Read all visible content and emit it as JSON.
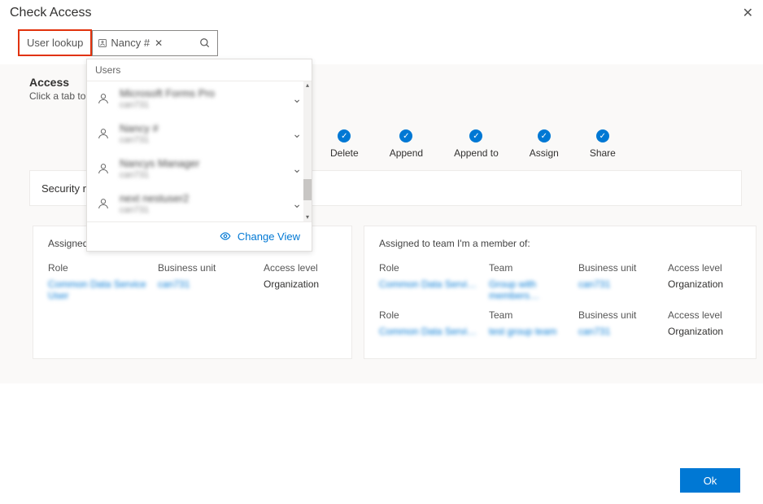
{
  "dialog": {
    "title": "Check Access",
    "close_aria": "Close"
  },
  "lookup": {
    "label": "User lookup",
    "chip_text": "Nancy #",
    "dropdown_header": "Users",
    "change_view": "Change View",
    "results": [
      {
        "primary": "Microsoft Forms Pro",
        "secondary": "can731"
      },
      {
        "primary": "Nancy #",
        "secondary": "can731"
      },
      {
        "primary": "Nancys Manager",
        "secondary": "can731"
      },
      {
        "primary": "next nestuser2",
        "secondary": "can731"
      }
    ]
  },
  "access": {
    "heading": "Access",
    "subtitle": "Click a tab to",
    "permissions": [
      {
        "label": "Delete"
      },
      {
        "label": "Append"
      },
      {
        "label": "Append to"
      },
      {
        "label": "Assign"
      },
      {
        "label": "Share"
      }
    ],
    "tab_label": "Security rol"
  },
  "direct_panel": {
    "title": "Assigned directly:",
    "headers": {
      "role": "Role",
      "bu": "Business unit",
      "al": "Access level"
    },
    "rows": [
      {
        "role": "Common Data Service User",
        "bu": "can731",
        "al": "Organization"
      }
    ]
  },
  "team_panel": {
    "title": "Assigned to team I'm a member of:",
    "headers": {
      "role": "Role",
      "team": "Team",
      "bu": "Business unit",
      "al": "Access level"
    },
    "rows": [
      {
        "role": "Common Data Servi…",
        "team": "Group with members…",
        "bu": "can731",
        "al": "Organization"
      },
      {
        "role": "Common Data Servi…",
        "team": "test group team",
        "bu": "can731",
        "al": "Organization"
      }
    ]
  },
  "footer": {
    "ok": "Ok"
  }
}
